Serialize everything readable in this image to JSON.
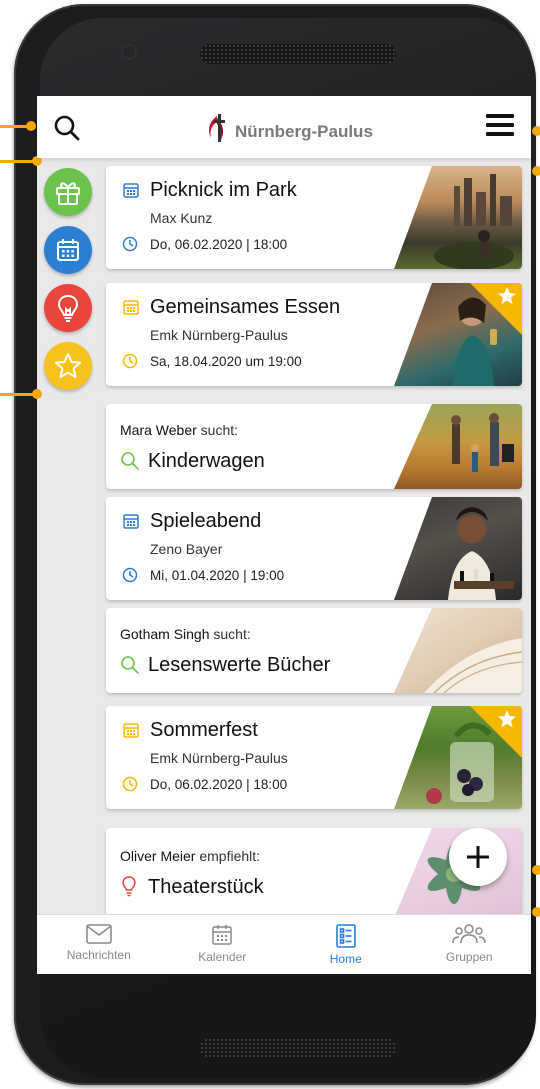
{
  "header": {
    "logo_text": "Nürnberg-Paulus",
    "search_icon": "search-icon",
    "menu_icon": "hamburger-menu-icon"
  },
  "side_actions": [
    {
      "icon": "gift-icon",
      "color": "#6cc24a"
    },
    {
      "icon": "calendar-icon",
      "color": "#2d7fd3"
    },
    {
      "icon": "lightbulb-icon",
      "color": "#e8453c"
    },
    {
      "icon": "star-icon",
      "color": "#f7c21b"
    }
  ],
  "feed": {
    "events": [
      {
        "title": "Picknick im Park",
        "organizer": "Max Kunz",
        "date": "Do, 06.02.2020 | 18:00",
        "accent": "#2d7fd3",
        "featured": false
      },
      {
        "title": "Gemeinsames Essen",
        "organizer": "Emk Nürnberg-Paulus",
        "date": "Sa, 18.04.2020 um 19:00",
        "accent": "#f5b800",
        "featured": true
      },
      {
        "title": "Spieleabend",
        "organizer": "Zeno Bayer",
        "date": "Mi, 01.04.2020 | 19:00",
        "accent": "#2d7fd3",
        "featured": false
      },
      {
        "title": "Sommerfest",
        "organizer": "Emk Nürnberg-Paulus",
        "date": "Do, 06.02.2020 | 18:00",
        "accent": "#f5b800",
        "featured": true
      }
    ],
    "posts": [
      {
        "name": "Mara Weber",
        "verb": "sucht:",
        "title": "Kinderwagen",
        "icon": "search-icon",
        "accent": "#6cc24a"
      },
      {
        "name": "Gotham Singh",
        "verb": "sucht:",
        "title": "Lesenswerte Bücher",
        "icon": "search-icon",
        "accent": "#6cc24a"
      },
      {
        "name": "Oliver Meier",
        "verb": "empfiehlt:",
        "title": "Theaterstück",
        "icon": "lightbulb-icon",
        "accent": "#e8453c"
      }
    ]
  },
  "fab": {
    "icon": "plus-icon"
  },
  "bottom_nav": [
    {
      "label": "Nachrichten",
      "icon": "mail-icon",
      "active": false
    },
    {
      "label": "Kalender",
      "icon": "calendar-icon",
      "active": false
    },
    {
      "label": "Home",
      "icon": "home-list-icon",
      "active": true
    },
    {
      "label": "Gruppen",
      "icon": "groups-icon",
      "active": false
    }
  ],
  "colors": {
    "callout": "#f4a900",
    "active_tab": "#1f7fe6"
  }
}
